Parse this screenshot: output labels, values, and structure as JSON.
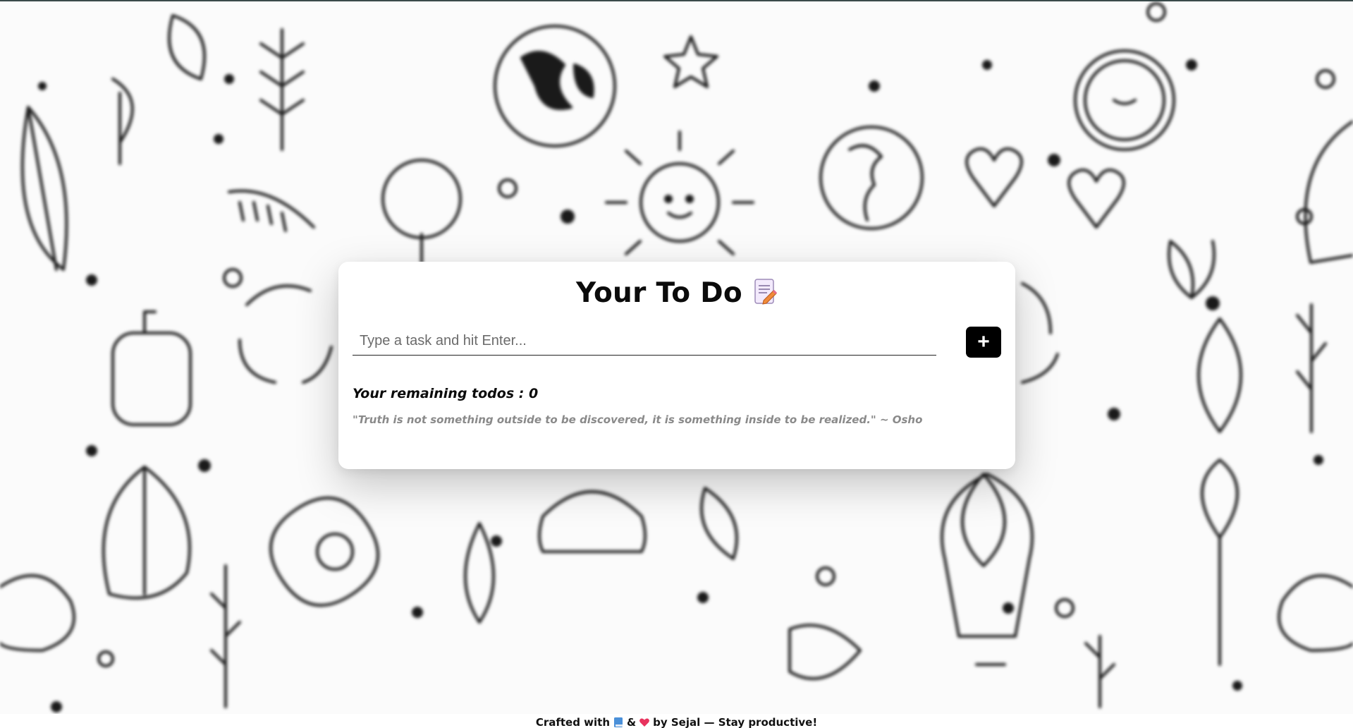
{
  "app": {
    "title": "Your To Do"
  },
  "input": {
    "placeholder": "Type a task and hit Enter...",
    "value": ""
  },
  "add_button": {
    "label": "+"
  },
  "status": {
    "remaining_text": "Your remaining todos : 0"
  },
  "quote": {
    "text": "\"Truth is not something outside to be discovered, it is something inside to be realized.\" ~ Osho"
  },
  "footer": {
    "prefix": "Crafted with",
    "amp": "&",
    "suffix": "by Sejal — Stay productive!"
  },
  "icons": {
    "title_icon": "memo-pencil-icon",
    "footer_icon_1": "book-icon",
    "footer_icon_2": "heart-icon"
  },
  "colors": {
    "accent": "#000000",
    "background": "#ffffff",
    "quote_text": "#8a8a8a",
    "heart": "#e8335e"
  }
}
